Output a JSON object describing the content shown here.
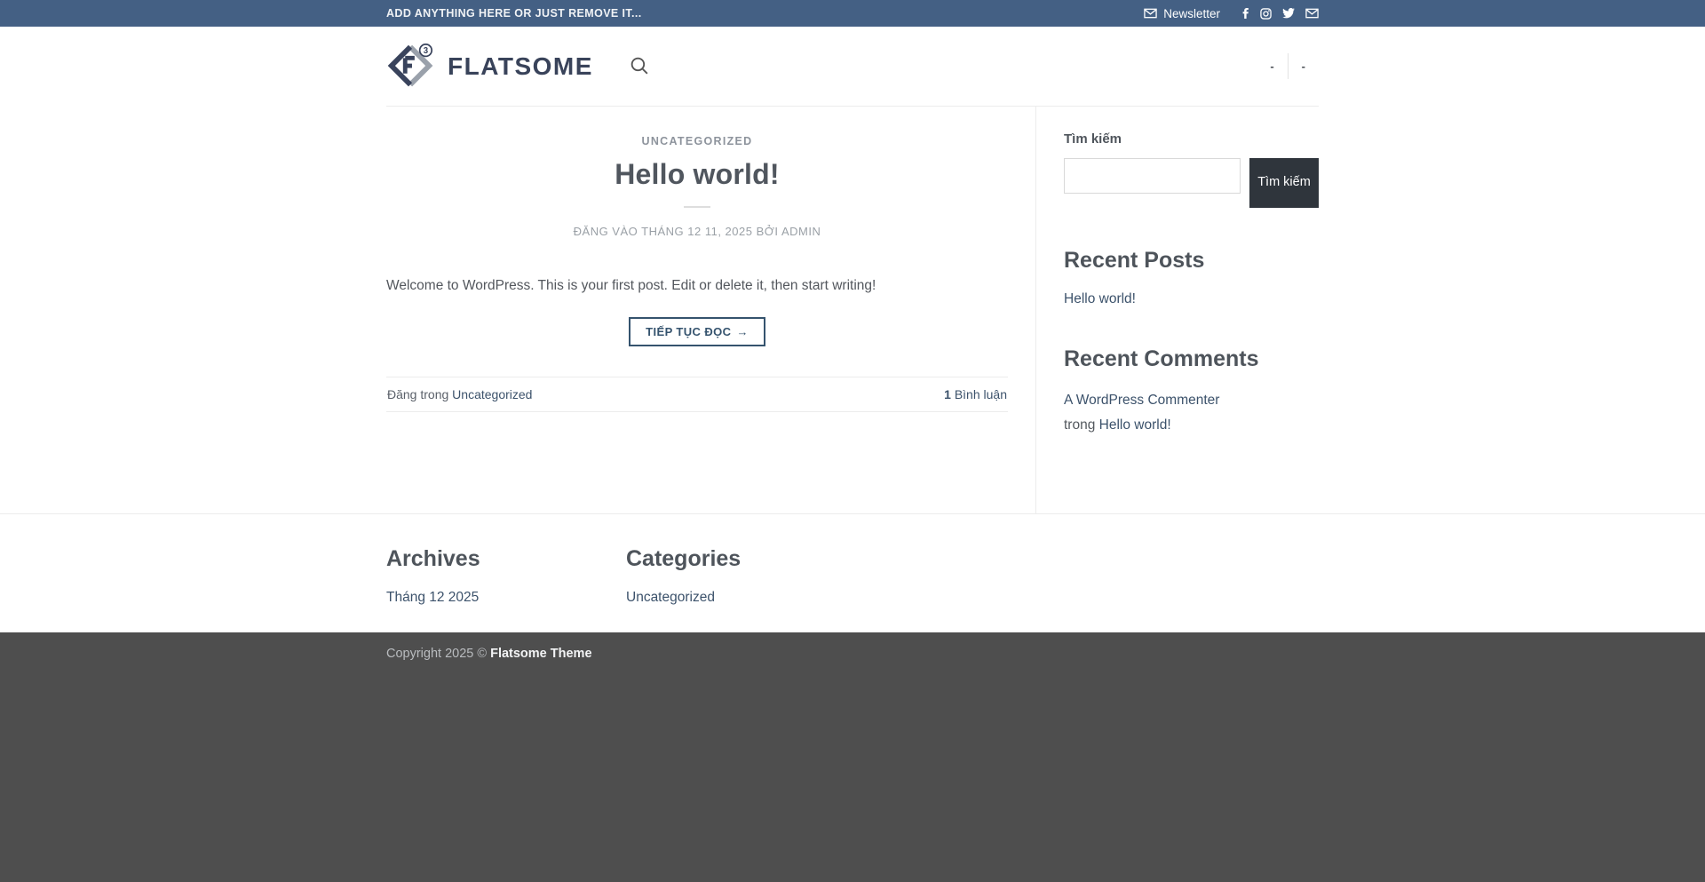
{
  "topbar": {
    "message": "ADD ANYTHING HERE OR JUST REMOVE IT...",
    "newsletter_label": "Newsletter",
    "social_icons": [
      "facebook",
      "instagram",
      "twitter",
      "email"
    ]
  },
  "header": {
    "logo_text": "FLATSOME",
    "logo_badge": "3",
    "nav_items": [
      "-",
      "-"
    ]
  },
  "post": {
    "category": "UNCATEGORIZED",
    "title": "Hello world!",
    "meta": {
      "prefix": "ĐĂNG VÀO",
      "date": "THÁNG 12 11, 2025",
      "by": "BỞI",
      "author": "ADMIN"
    },
    "body": "Welcome to WordPress. This is your first post. Edit or delete it, then start writing!",
    "read_more_label": "TIẾP TỤC ĐỌC",
    "read_more_arrow": "→",
    "footer_meta": {
      "posted_in_label": "Đăng trong",
      "category_link": "Uncategorized",
      "comments_count": "1",
      "comments_label": "Bình luận"
    }
  },
  "sidebar": {
    "search": {
      "title": "Tìm kiếm",
      "input_value": "",
      "button_label": "Tìm kiếm"
    },
    "recent_posts": {
      "title": "Recent Posts",
      "items": [
        "Hello world!"
      ]
    },
    "recent_comments": {
      "title": "Recent Comments",
      "items": [
        {
          "author": "A WordPress Commenter",
          "connector": "trong",
          "post": "Hello world!"
        }
      ]
    }
  },
  "footer": {
    "archives": {
      "title": "Archives",
      "items": [
        "Tháng 12 2025"
      ]
    },
    "categories": {
      "title": "Categories",
      "items": [
        "Uncategorized"
      ]
    },
    "copyright": {
      "prefix": "Copyright 2025 ©",
      "brand": "Flatsome Theme"
    }
  },
  "colors": {
    "primary": "#446084",
    "link": "#3c526b",
    "button_dark": "#2f353c",
    "copyright_bg": "#4e4e4e",
    "border": "#ececec"
  }
}
